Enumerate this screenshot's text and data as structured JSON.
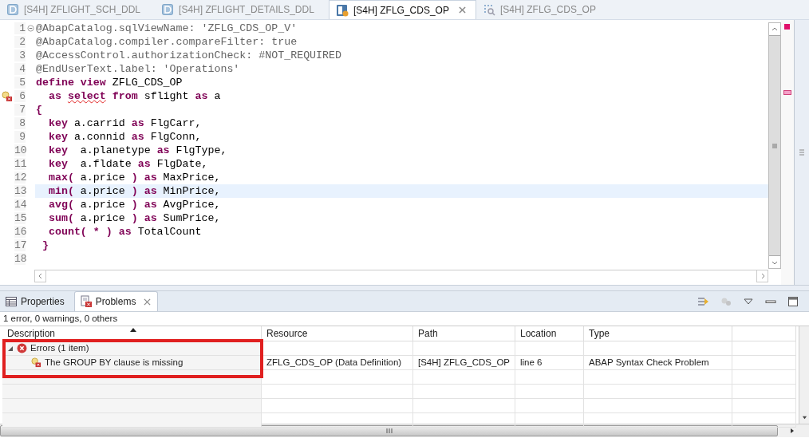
{
  "editor_tabs": [
    {
      "label": "[S4H] ZFLIGHT_SCH_DDL",
      "kind": "ddl",
      "selected": false,
      "closable": false
    },
    {
      "label": "[S4H] ZFLIGHT_DETAILS_DDL",
      "kind": "ddl",
      "selected": false,
      "closable": false
    },
    {
      "label": "[S4H] ZFLG_CDS_OP",
      "kind": "cds",
      "selected": true,
      "closable": true
    },
    {
      "label": "[S4H] ZFLG_CDS_OP",
      "kind": "preview",
      "selected": false,
      "closable": false
    }
  ],
  "editor": {
    "lines": [
      {
        "number": "1",
        "fold": true,
        "error": false,
        "current": false,
        "tokens": [
          {
            "text": "@AbapCatalog.sqlViewName: 'ZFLG_CDS_OP_V'",
            "kind": "annotation"
          }
        ]
      },
      {
        "number": "2",
        "fold": false,
        "error": false,
        "current": false,
        "tokens": [
          {
            "text": "@AbapCatalog.compiler.compareFilter: true",
            "kind": "annotation"
          }
        ]
      },
      {
        "number": "3",
        "fold": false,
        "error": false,
        "current": false,
        "tokens": [
          {
            "text": "@AccessControl.authorizationCheck: #NOT_REQUIRED",
            "kind": "annotation"
          }
        ]
      },
      {
        "number": "4",
        "fold": false,
        "error": false,
        "current": false,
        "tokens": [
          {
            "text": "@EndUserText.label: 'Operations'",
            "kind": "annotation"
          }
        ]
      },
      {
        "number": "5",
        "fold": false,
        "error": false,
        "current": false,
        "tokens": [
          {
            "text": "define view",
            "kind": "keyword"
          },
          {
            "text": " ZFLG_CDS_OP",
            "kind": "text"
          }
        ]
      },
      {
        "number": "6",
        "fold": false,
        "error": true,
        "current": false,
        "tokens": [
          {
            "text": "  as ",
            "kind": "keyword"
          },
          {
            "text": "select",
            "kind": "keyword",
            "error": true
          },
          {
            "text": " from",
            "kind": "keyword"
          },
          {
            "text": " sflight ",
            "kind": "text"
          },
          {
            "text": "as",
            "kind": "keyword"
          },
          {
            "text": " a",
            "kind": "text"
          }
        ]
      },
      {
        "number": "7",
        "fold": false,
        "error": false,
        "current": false,
        "tokens": [
          {
            "text": "{",
            "kind": "keyword"
          }
        ]
      },
      {
        "number": "8",
        "fold": false,
        "error": false,
        "current": false,
        "tokens": [
          {
            "text": "  key",
            "kind": "keyword"
          },
          {
            "text": " a.carrid ",
            "kind": "text"
          },
          {
            "text": "as",
            "kind": "keyword"
          },
          {
            "text": " FlgCarr,",
            "kind": "text"
          }
        ]
      },
      {
        "number": "9",
        "fold": false,
        "error": false,
        "current": false,
        "tokens": [
          {
            "text": "  key",
            "kind": "keyword"
          },
          {
            "text": " a.connid ",
            "kind": "text"
          },
          {
            "text": "as",
            "kind": "keyword"
          },
          {
            "text": " FlgConn,",
            "kind": "text"
          }
        ]
      },
      {
        "number": "10",
        "fold": false,
        "error": false,
        "current": false,
        "tokens": [
          {
            "text": "  key",
            "kind": "keyword"
          },
          {
            "text": "  a.planetype ",
            "kind": "text"
          },
          {
            "text": "as",
            "kind": "keyword"
          },
          {
            "text": " FlgType,",
            "kind": "text"
          }
        ]
      },
      {
        "number": "11",
        "fold": false,
        "error": false,
        "current": false,
        "tokens": [
          {
            "text": "  key",
            "kind": "keyword"
          },
          {
            "text": "  a.fldate ",
            "kind": "text"
          },
          {
            "text": "as",
            "kind": "keyword"
          },
          {
            "text": " FlgDate,",
            "kind": "text"
          }
        ]
      },
      {
        "number": "12",
        "fold": false,
        "error": false,
        "current": false,
        "tokens": [
          {
            "text": "  max(",
            "kind": "keyword"
          },
          {
            "text": " a.price ",
            "kind": "text"
          },
          {
            "text": ") as",
            "kind": "keyword"
          },
          {
            "text": " MaxPrice,",
            "kind": "text"
          }
        ]
      },
      {
        "number": "13",
        "fold": false,
        "error": false,
        "current": true,
        "tokens": [
          {
            "text": "  min(",
            "kind": "keyword"
          },
          {
            "text": " a.price ",
            "kind": "text"
          },
          {
            "text": ") as",
            "kind": "keyword"
          },
          {
            "text": " MinPrice,",
            "kind": "text"
          }
        ]
      },
      {
        "number": "14",
        "fold": false,
        "error": false,
        "current": false,
        "tokens": [
          {
            "text": "  avg(",
            "kind": "keyword"
          },
          {
            "text": " a.price ",
            "kind": "text"
          },
          {
            "text": ") as",
            "kind": "keyword"
          },
          {
            "text": " AvgPrice,",
            "kind": "text"
          }
        ]
      },
      {
        "number": "15",
        "fold": false,
        "error": false,
        "current": false,
        "tokens": [
          {
            "text": "  sum(",
            "kind": "keyword"
          },
          {
            "text": " a.price ",
            "kind": "text"
          },
          {
            "text": ") as",
            "kind": "keyword"
          },
          {
            "text": " SumPrice,",
            "kind": "text"
          }
        ]
      },
      {
        "number": "16",
        "fold": false,
        "error": false,
        "current": false,
        "tokens": [
          {
            "text": "  count( * ) as",
            "kind": "keyword"
          },
          {
            "text": " TotalCount",
            "kind": "text"
          }
        ]
      },
      {
        "number": "17",
        "fold": false,
        "error": false,
        "current": false,
        "tokens": [
          {
            "text": " }",
            "kind": "keyword"
          }
        ]
      },
      {
        "number": "18",
        "fold": false,
        "error": false,
        "current": false
      }
    ]
  },
  "panel_tabs": [
    {
      "label": "Properties",
      "kind": "properties",
      "selected": false,
      "closable": false
    },
    {
      "label": "Problems",
      "kind": "problems",
      "selected": true,
      "closable": true
    }
  ],
  "problems": {
    "summary": "1 error, 0 warnings, 0 others",
    "highlight": true,
    "columns": [
      "Description",
      "Resource",
      "Path",
      "Location",
      "Type"
    ],
    "groups": [
      {
        "label": "Errors (1 item)",
        "expanded": true,
        "children": [
          {
            "description": "The GROUP BY clause is missing",
            "resource": "ZFLG_CDS_OP (Data Definition)",
            "path": "[S4H] ZFLG_CDS_OP",
            "location": "line 6",
            "type": "ABAP Syntax Check Problem"
          }
        ]
      }
    ]
  }
}
